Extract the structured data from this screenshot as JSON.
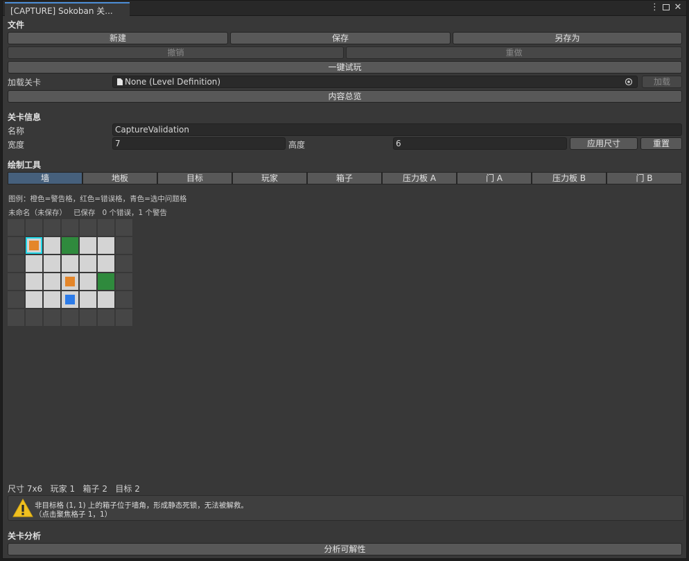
{
  "window": {
    "tab_title": "[CAPTURE] Sokoban 关...",
    "more_glyph": "⋮",
    "close_glyph": "✕"
  },
  "file_section": {
    "header": "文件",
    "new": "新建",
    "save": "保存",
    "save_as": "另存为",
    "undo": "撤销",
    "redo": "重做",
    "quick_play": "一键试玩",
    "load_label": "加载关卡",
    "load_value": "None (Level Definition)",
    "load_button": "加载",
    "overview": "内容总览"
  },
  "level_info": {
    "header": "关卡信息",
    "name_label": "名称",
    "name_value": "CaptureValidation",
    "width_label": "宽度",
    "width_value": "7",
    "height_label": "高度",
    "height_value": "6",
    "apply_size": "应用尺寸",
    "reset": "重置"
  },
  "paint_tools": {
    "header": "绘制工具",
    "tools": [
      "墙",
      "地板",
      "目标",
      "玩家",
      "箱子",
      "压力板 A",
      "门 A",
      "压力板 B",
      "门 B"
    ],
    "selected": "墙"
  },
  "legend": "图例：橙色=警告格，红色=错误格，青色=选中问题格",
  "status_line": "未命名（未保存）   已保存   0 个错误，1 个警告",
  "grid": {
    "cols": 7,
    "rows": 6,
    "cells": [
      [
        "wall",
        "wall",
        "wall",
        "wall",
        "wall",
        "wall",
        "wall"
      ],
      [
        "wall",
        "floor",
        "floor",
        "goal",
        "floor",
        "floor",
        "wall"
      ],
      [
        "wall",
        "floor",
        "floor",
        "floor",
        "floor",
        "floor",
        "wall"
      ],
      [
        "wall",
        "floor",
        "floor",
        "floor",
        "floor",
        "goal",
        "wall"
      ],
      [
        "wall",
        "floor",
        "floor",
        "floor",
        "floor",
        "floor",
        "wall"
      ],
      [
        "wall",
        "wall",
        "wall",
        "wall",
        "wall",
        "wall",
        "wall"
      ]
    ],
    "boxes": [
      [
        1,
        1
      ],
      [
        3,
        3
      ]
    ],
    "player": [
      3,
      4
    ],
    "selected_issue": [
      1,
      1
    ],
    "colors": {
      "wall": "#464646",
      "floor": "#d4d4d4",
      "goal": "#2f8a3d",
      "box": "#e4862a",
      "player": "#2c7be8",
      "selected": "#20d8e8"
    }
  },
  "summary": "尺寸 7x6   玩家 1   箱子 2   目标 2",
  "warning": {
    "icon": "warning-triangle-icon",
    "line1": "非目标格 (1, 1) 上的箱子位于墙角，形成静态死锁，无法被解救。",
    "line2": "（点击聚焦格子 1，1）"
  },
  "analysis": {
    "header": "关卡分析",
    "button": "分析可解性"
  }
}
